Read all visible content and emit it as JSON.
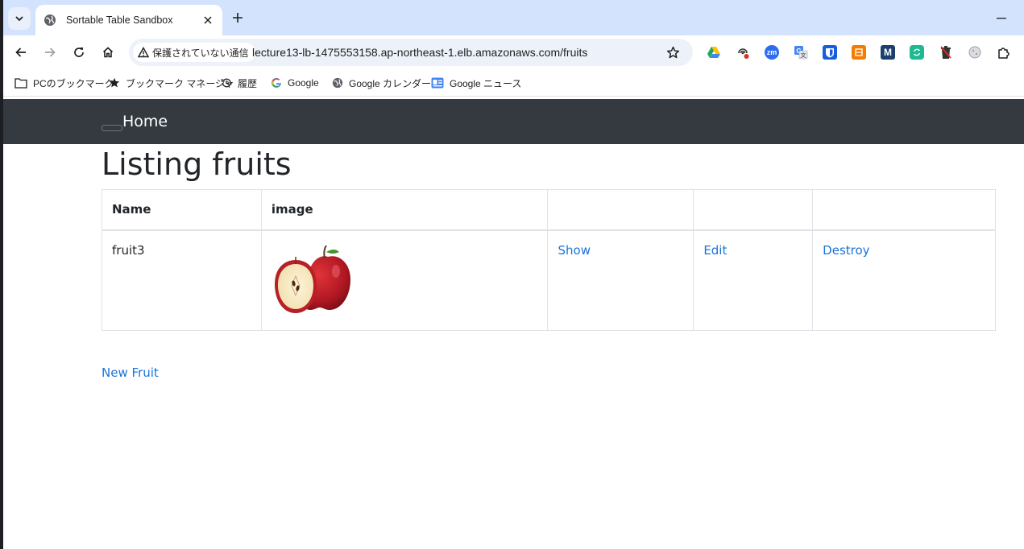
{
  "browser": {
    "tab_title": "Sortable Table Sandbox",
    "security_label": "保護されていない通信",
    "url": "lecture13-lb-1475553158.ap-northeast-1.elb.amazonaws.com/fruits",
    "extensions": [
      {
        "name": "google-drive-icon"
      },
      {
        "name": "podcast-icon"
      },
      {
        "name": "zoom-icon",
        "text": "zm",
        "color": "#2d6bf0"
      },
      {
        "name": "translate-icon"
      },
      {
        "name": "bitwarden-icon"
      },
      {
        "name": "orange-extension-icon"
      },
      {
        "name": "m-extension-icon",
        "text": "M",
        "color": "#1c3f6e"
      },
      {
        "name": "sync-extension-icon"
      },
      {
        "name": "delete-extension-icon"
      },
      {
        "name": "cookie-extension-icon"
      },
      {
        "name": "extensions-puzzle-icon"
      }
    ]
  },
  "bookmarks": [
    {
      "label": "PCのブックマーク",
      "icon": "folder-icon"
    },
    {
      "label": "ブックマーク マネージャ",
      "icon": "star-icon"
    },
    {
      "label": "履歴",
      "icon": "history-icon"
    },
    {
      "label": "Google",
      "icon": "google-icon"
    },
    {
      "label": "Google カレンダー",
      "icon": "globe-icon"
    },
    {
      "label": "Google ニュース",
      "icon": "google-news-icon"
    }
  ],
  "page": {
    "nav_brand": "Home",
    "title": "Listing fruits",
    "table": {
      "headers": [
        "Name",
        "image",
        "",
        "",
        ""
      ],
      "rows": [
        {
          "name": "fruit3",
          "image": "apple-image",
          "show": "Show",
          "edit": "Edit",
          "destroy": "Destroy"
        }
      ]
    },
    "new_link": "New Fruit"
  },
  "colors": {
    "navbar": "#343a40",
    "link": "#1a73d9",
    "tab_strip": "#d3e3fd",
    "omnibox": "#edf2fa"
  }
}
